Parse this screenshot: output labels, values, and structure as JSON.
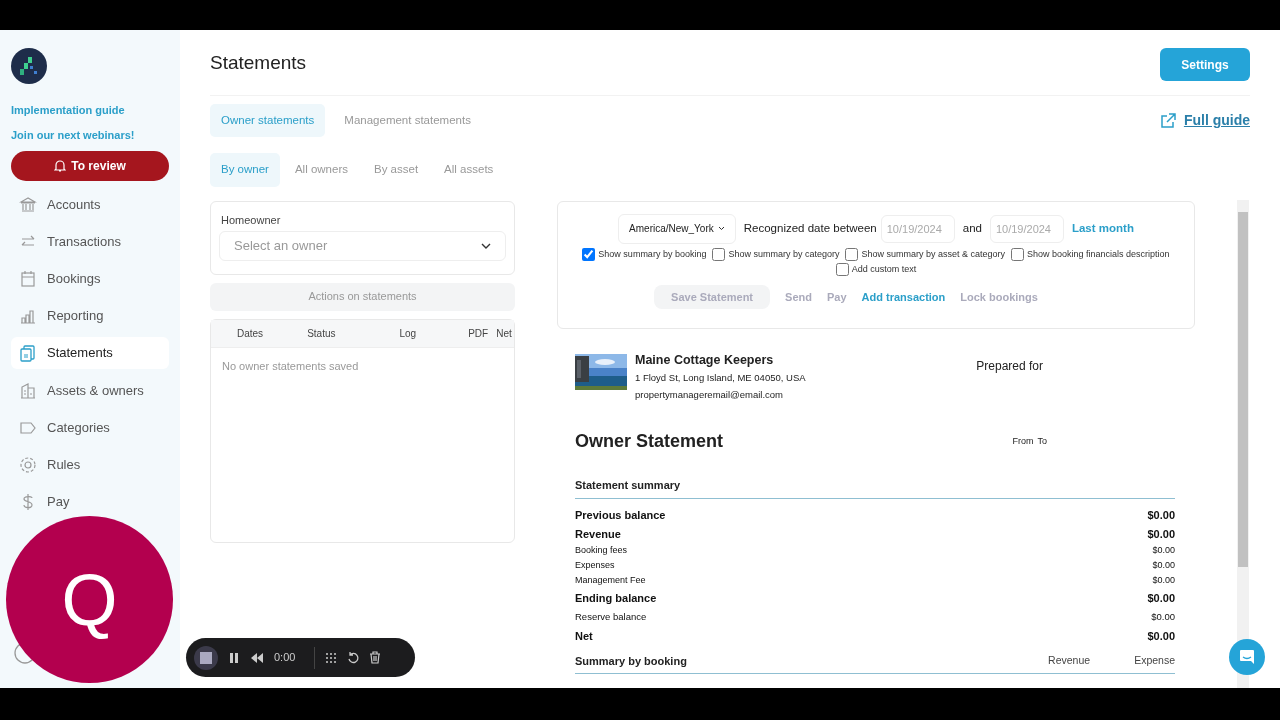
{
  "sidebar": {
    "links": [
      "Implementation guide",
      "Join our next webinars!"
    ],
    "review_button": "To review",
    "items": [
      {
        "label": "Accounts",
        "selected": false
      },
      {
        "label": "Transactions",
        "selected": false
      },
      {
        "label": "Bookings",
        "selected": false
      },
      {
        "label": "Reporting",
        "selected": false
      },
      {
        "label": "Statements",
        "selected": true
      },
      {
        "label": "Assets & owners",
        "selected": false
      },
      {
        "label": "Categories",
        "selected": false
      },
      {
        "label": "Rules",
        "selected": false
      },
      {
        "label": "Pay",
        "selected": false
      }
    ]
  },
  "page": {
    "title": "Statements",
    "settings_button": "Settings",
    "full_guide": "Full guide"
  },
  "tabs": [
    {
      "label": "Owner statements",
      "selected": true
    },
    {
      "label": "Management statements",
      "selected": false
    }
  ],
  "subtabs": [
    {
      "label": "By owner",
      "selected": true
    },
    {
      "label": "All owners",
      "selected": false
    },
    {
      "label": "By asset",
      "selected": false
    },
    {
      "label": "All assets",
      "selected": false
    }
  ],
  "homeowner": {
    "label": "Homeowner",
    "placeholder": "Select an owner"
  },
  "actions_button": "Actions on statements",
  "saved_table": {
    "columns": [
      "Dates",
      "Status",
      "Log",
      "PDF",
      "Net"
    ],
    "empty": "No owner statements saved"
  },
  "controls": {
    "timezone": "America/New_York",
    "date_label": "Recognized date between",
    "from": "10/19/2024",
    "and": "and",
    "to": "10/19/2024",
    "preset": "Last month",
    "options": [
      {
        "label": "Show summary by booking",
        "checked": true
      },
      {
        "label": "Show summary by category",
        "checked": false
      },
      {
        "label": "Show summary by asset & category",
        "checked": false
      },
      {
        "label": "Show booking financials description",
        "checked": false
      },
      {
        "label": "Add custom text",
        "checked": false
      }
    ],
    "actions": [
      {
        "label": "Save Statement",
        "kind": "button"
      },
      {
        "label": "Send",
        "kind": "muted"
      },
      {
        "label": "Pay",
        "kind": "muted"
      },
      {
        "label": "Add transaction",
        "kind": "link"
      },
      {
        "label": "Lock bookings",
        "kind": "muted"
      }
    ]
  },
  "statement": {
    "company": "Maine Cottage Keepers",
    "address": "1 Floyd St, Long Island, ME 04050, USA",
    "email": "propertymanageremail@email.com",
    "prepared_for": "Prepared for",
    "title": "Owner Statement",
    "from": "From",
    "to": "To",
    "summary_title": "Statement summary",
    "rows": [
      {
        "label": "Previous balance",
        "value": "$0.00",
        "kind": "major"
      },
      {
        "label": "Revenue",
        "value": "$0.00",
        "kind": "major"
      },
      {
        "label": "Booking fees",
        "value": "$0.00",
        "kind": "minor"
      },
      {
        "label": "Expenses",
        "value": "$0.00",
        "kind": "minor"
      },
      {
        "label": "Management Fee",
        "value": "$0.00",
        "kind": "minor"
      },
      {
        "label": "Ending balance",
        "value": "$0.00",
        "kind": "major"
      },
      {
        "label": "Reserve balance",
        "value": "$0.00",
        "kind": "sub"
      },
      {
        "label": "Net",
        "value": "$0.00",
        "kind": "major"
      }
    ],
    "booking_title": "Summary by booking",
    "booking_columns": [
      "Revenue",
      "Expense"
    ]
  },
  "recorder": {
    "time": "0:00"
  },
  "camera_letter": "Q"
}
